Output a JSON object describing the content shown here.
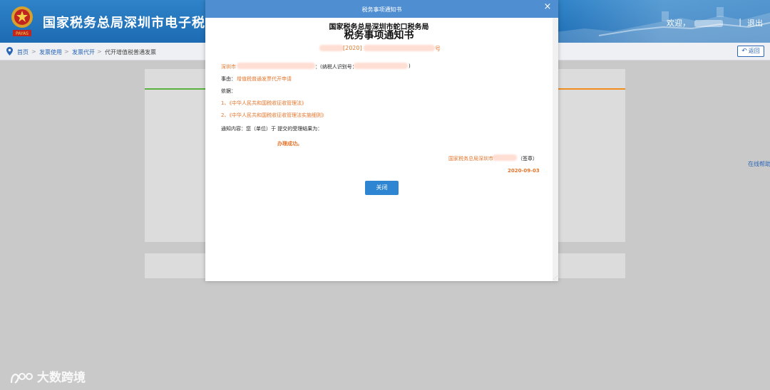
{
  "header": {
    "site_title": "国家税务总局深圳市电子税务局",
    "emblem_icon": "tax-emblem-icon",
    "welcome_label": "欢迎，",
    "separator": "|",
    "logout_label": "退出",
    "emblem_text": "PAYAS"
  },
  "breadcrumb": {
    "items": [
      "首页",
      "发票使用",
      "发票代开",
      "代开增值税普通发票"
    ],
    "arrow": ">",
    "back_label": "返回"
  },
  "help_label": "在线帮助",
  "modal": {
    "title": "税务事项通知书",
    "close_icon": "×",
    "org": "国家税务总局深圳市蛇口税务局",
    "doc_title": "税务事项通知书",
    "doc_number_prefix": "[2020]",
    "doc_number_suffix": "号",
    "taxpayer_prefix": "深圳市",
    "taxpayer_id_label": "：(纳税人识别号：",
    "taxpayer_id_close": ")",
    "reason_label": "事由：",
    "reason_value": "增值税普通发票代开申请",
    "basis_label": "依据：",
    "basis_1": "1、《中华人民共和国税收征收管理法》",
    "basis_2": "2、《中华人民共和国税收征收管理法实施细则》",
    "notice_content": "通知内容：您（单位）于 提交的受理结果为：",
    "result": "办理成功。",
    "signer_prefix": "国家税务总局深圳市",
    "signer_seal": "（签章）",
    "date": "2020-09-03",
    "close_button": "关闭"
  },
  "watermark": "大数跨境",
  "colors": {
    "header_blue": "#1d6bb3",
    "modal_title_blue": "#4f8fd1",
    "accent_orange": "#e3742a",
    "button_blue": "#2e86d3",
    "link_blue": "#2b66b5"
  }
}
